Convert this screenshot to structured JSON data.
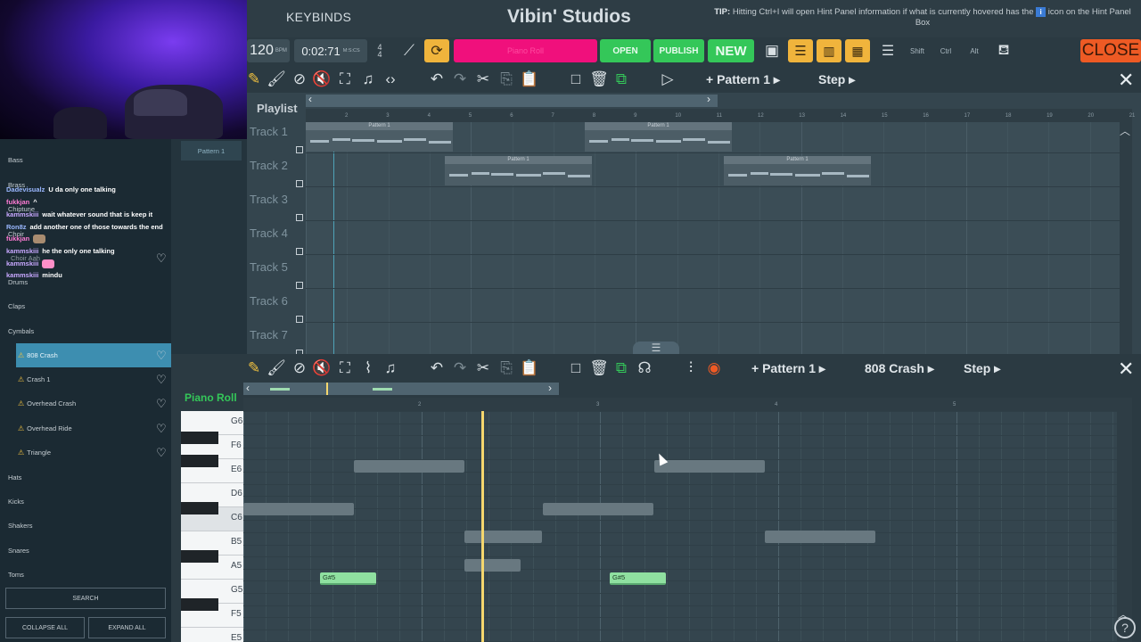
{
  "header": {
    "keybinds": "KEYBINDS",
    "studio_name": "Vibin' Studios",
    "tip_prefix": "TIP:",
    "tip_text": "Hitting Ctrl+I will open Hint Panel information if what is currently hovered has the",
    "tip_icon": "i",
    "tip_suffix": "icon on the Hint Panel Box",
    "close_label": "CLOSE"
  },
  "transport": {
    "bpm": "120",
    "bpm_unit": "BPM",
    "time": "0:02:71",
    "time_unit": "M:S:CS",
    "sig_top": "4",
    "sig_bottom": "4",
    "current_tool": "Piano Roll",
    "open_label": "OPEN",
    "publish_label": "PUBLISH",
    "new_label": "NEW",
    "shift_label": "Shift",
    "ctrl_label": "Ctrl",
    "alt_label": "Alt"
  },
  "playlist_toolbar": {
    "pattern_label": "Pattern 1",
    "step_label": "Step"
  },
  "playlist": {
    "title": "Playlist",
    "ruler": [
      "2",
      "3",
      "4",
      "5",
      "6",
      "7",
      "8",
      "9",
      "10",
      "11",
      "12",
      "13",
      "14",
      "15",
      "16",
      "17",
      "18",
      "19",
      "20",
      "21"
    ],
    "tracks": [
      "Track 1",
      "Track 2",
      "Track 3",
      "Track 4",
      "Track 5",
      "Track 6",
      "Track 7"
    ],
    "clip_label": "Pattern 1"
  },
  "pattern_list": {
    "item": "Pattern 1"
  },
  "instruments": {
    "categories": [
      "Bass",
      "Brass",
      "Chiptune",
      "Choir",
      "Drums"
    ],
    "choir_item": "Choir Aah",
    "drums_sub": [
      "Claps",
      "Cymbals"
    ],
    "cymbals": [
      "808 Crash",
      "Crash 1",
      "Overhead Crash",
      "Overhead Ride",
      "Triangle"
    ],
    "more": [
      "Hats",
      "Kicks",
      "Shakers",
      "Snares",
      "Toms"
    ],
    "search_label": "SEARCH",
    "collapse_label": "COLLAPSE ALL",
    "expand_label": "EXPAND ALL"
  },
  "chat": [
    {
      "user": "Dadevisualz",
      "msg": "U da only one talking",
      "color": "#9ab8ff"
    },
    {
      "user": "fukkjan",
      "msg": "^",
      "color": "#ff7bd5"
    },
    {
      "user": "kammskiii",
      "msg": "wait whatever sound that is keep it",
      "color": "#c8a8ff"
    },
    {
      "user": "Ron8z",
      "msg": "add another one of those towards the end",
      "color": "#9ab8ff"
    },
    {
      "user": "fukkjan",
      "msg": "",
      "color": "#ff7bd5"
    },
    {
      "user": "kammskiii",
      "msg": "he the only one talking",
      "color": "#c8a8ff"
    },
    {
      "user": "kammskiii",
      "msg": "",
      "color": "#c8a8ff"
    },
    {
      "user": "kammskiii",
      "msg": "mindu",
      "color": "#c8a8ff"
    }
  ],
  "piano_toolbar": {
    "pattern_label": "Pattern 1",
    "instrument_label": "808 Crash",
    "step_label": "Step"
  },
  "piano_roll": {
    "title": "Piano Roll",
    "ruler": [
      "2",
      "3",
      "4",
      "5"
    ],
    "keys": [
      "G6",
      "F6",
      "E6",
      "D6",
      "C6",
      "B5",
      "A5",
      "G5",
      "F5",
      "E5"
    ],
    "highlighted_notes": [
      "G#5",
      "G#5"
    ]
  },
  "colors": {
    "accent_pink": "#f0107c",
    "accent_green": "#34c759",
    "close_red": "#ee5a24",
    "selection_blue": "#3d8eb0",
    "playhead": "#f5d76e"
  }
}
